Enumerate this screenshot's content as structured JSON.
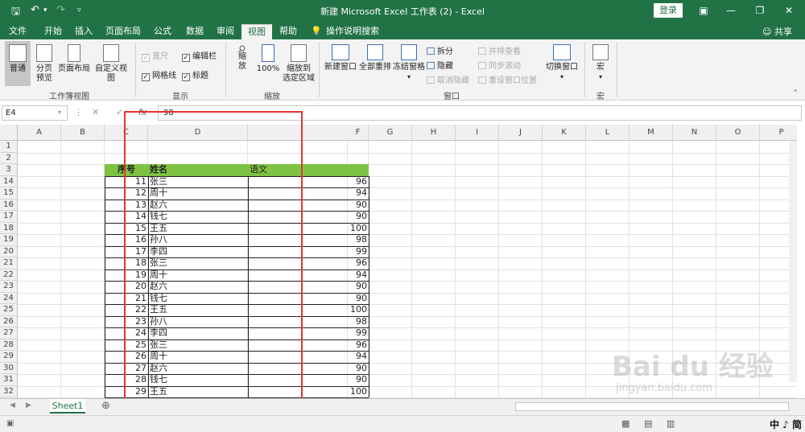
{
  "window": {
    "title": "新建 Microsoft Excel 工作表 (2)  -  Excel",
    "login_label": "登录",
    "share_label": "共享"
  },
  "tabs": [
    "文件",
    "开始",
    "插入",
    "页面布局",
    "公式",
    "数据",
    "审阅",
    "视图",
    "帮助",
    "操作说明搜索"
  ],
  "active_tab": "视图",
  "ribbon": {
    "normal": "普通",
    "page_break_1": "分页",
    "page_break_2": "预览",
    "page_layout": "页面布局",
    "custom_view": "自定义视图",
    "ruler": "直尺",
    "formula_bar": "编辑栏",
    "gridlines": "网格线",
    "headings": "标题",
    "zoom_1": "缩",
    "zoom_2": "放",
    "zoom_100": "100%",
    "zoom_sel_1": "缩放到",
    "zoom_sel_2": "选定区域",
    "new_window": "新建窗口",
    "arrange_all": "全部重排",
    "freeze": "冻结窗格",
    "split": "拆分",
    "hide": "隐藏",
    "unhide": "取消隐藏",
    "side_by_side": "并排查看",
    "sync_scroll": "同步滚动",
    "reset_pos": "重设窗口位置",
    "switch_window": "切换窗口",
    "macro": "宏",
    "group_views": "工作簿视图",
    "group_show": "显示",
    "group_zoom": "缩放",
    "group_window": "窗口",
    "group_macro": "宏"
  },
  "formula": {
    "name_box": "E4",
    "value": "98"
  },
  "columns": [
    "A",
    "B",
    "C",
    "D",
    "E",
    "F",
    "G",
    "H",
    "I",
    "J",
    "K",
    "L",
    "M",
    "N",
    "O",
    "P"
  ],
  "row_numbers": [
    "1",
    "2",
    "3",
    "14",
    "15",
    "16",
    "17",
    "18",
    "19",
    "20",
    "21",
    "22",
    "23",
    "24",
    "25",
    "26",
    "27",
    "28",
    "29",
    "30",
    "31",
    "32"
  ],
  "table": {
    "headers": [
      "序号",
      "姓名",
      "语文"
    ],
    "rows": [
      [
        "11",
        "张三",
        "96"
      ],
      [
        "12",
        "周十",
        "94"
      ],
      [
        "13",
        "赵六",
        "90"
      ],
      [
        "14",
        "钱七",
        "90"
      ],
      [
        "15",
        "王五",
        "100"
      ],
      [
        "16",
        "孙八",
        "98"
      ],
      [
        "17",
        "李四",
        "99"
      ],
      [
        "18",
        "张三",
        "96"
      ],
      [
        "19",
        "周十",
        "94"
      ],
      [
        "20",
        "赵六",
        "90"
      ],
      [
        "21",
        "钱七",
        "90"
      ],
      [
        "22",
        "王五",
        "100"
      ],
      [
        "23",
        "孙八",
        "98"
      ],
      [
        "24",
        "李四",
        "99"
      ],
      [
        "25",
        "张三",
        "96"
      ],
      [
        "26",
        "周十",
        "94"
      ],
      [
        "27",
        "赵六",
        "90"
      ],
      [
        "28",
        "钱七",
        "90"
      ],
      [
        "29",
        "王五",
        "100"
      ]
    ]
  },
  "sheet": {
    "name": "Sheet1"
  },
  "watermark": {
    "text": "Bai du 经验",
    "sub": "jingyan.baidu.com"
  },
  "ime": "中 ♪ 简"
}
